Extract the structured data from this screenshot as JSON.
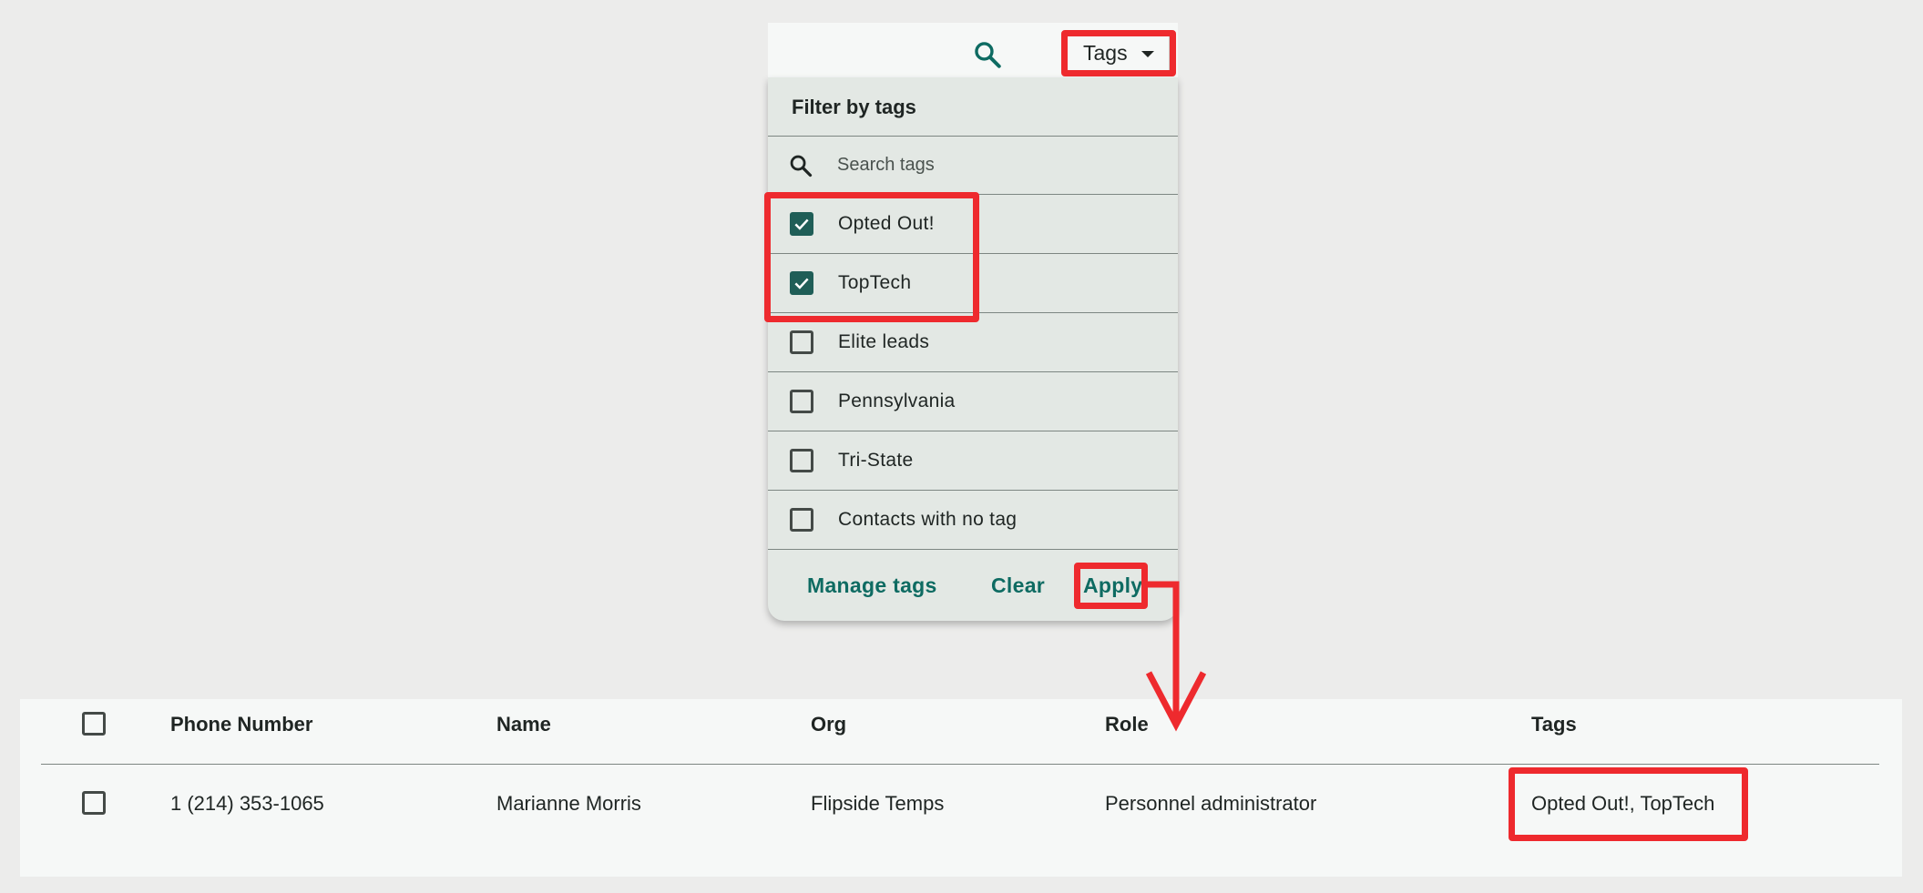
{
  "toolbar": {
    "search_icon": "search-icon",
    "tags_button_label": "Tags"
  },
  "filter_panel": {
    "title": "Filter by tags",
    "search_placeholder": "Search tags",
    "tags": [
      {
        "label": "Opted Out!",
        "checked": true
      },
      {
        "label": "TopTech",
        "checked": true
      },
      {
        "label": "Elite leads",
        "checked": false
      },
      {
        "label": "Pennsylvania",
        "checked": false
      },
      {
        "label": "Tri-State",
        "checked": false
      },
      {
        "label": "Contacts with no tag",
        "checked": false
      }
    ],
    "actions": {
      "manage": "Manage tags",
      "clear": "Clear",
      "apply": "Apply"
    }
  },
  "table": {
    "headers": {
      "phone": "Phone Number",
      "name": "Name",
      "org": "Org",
      "role": "Role",
      "tags": "Tags"
    },
    "rows": [
      {
        "phone": "1 (214) 353-1065",
        "name": "Marianne Morris",
        "org": "Flipside Temps",
        "role": "Personnel administrator",
        "tags": "Opted Out!, TopTech"
      }
    ]
  },
  "colors": {
    "accent": "#0e6b62",
    "checkbox_checked": "#1f5e57",
    "highlight": "#ee2a2e",
    "panel_bg": "#e3e8e4",
    "page_bg": "#ececeb"
  }
}
